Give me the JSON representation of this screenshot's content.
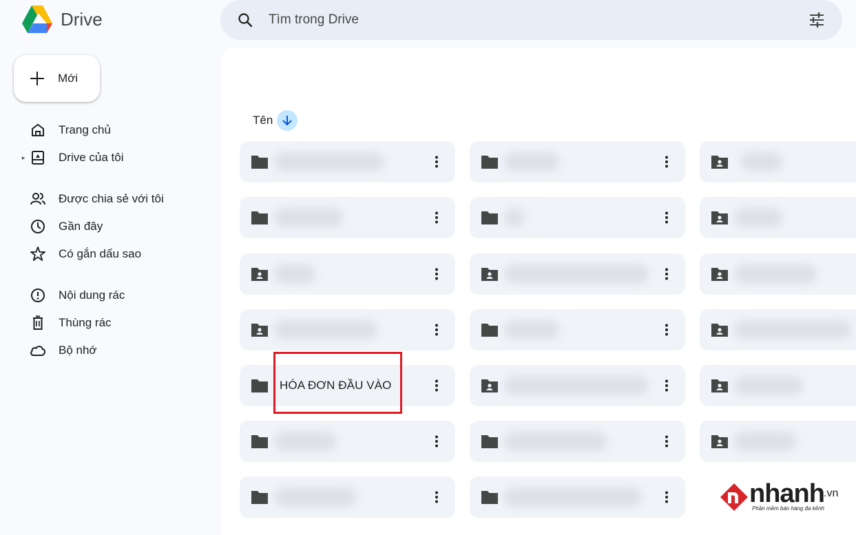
{
  "app": {
    "name": "Drive"
  },
  "search": {
    "placeholder": "Tìm trong Drive"
  },
  "new_button": {
    "label": "Mới"
  },
  "sidebar": {
    "items": [
      {
        "label": "Trang chủ",
        "icon": "home-icon"
      },
      {
        "label": "Drive của tôi",
        "icon": "my-drive-icon"
      },
      {
        "label": "Được chia sẻ với tôi",
        "icon": "shared-people-icon"
      },
      {
        "label": "Gần đây",
        "icon": "clock-icon"
      },
      {
        "label": "Có gắn dấu sao",
        "icon": "star-icon"
      },
      {
        "label": "Nội dung rác",
        "icon": "spam-icon"
      },
      {
        "label": "Thùng rác",
        "icon": "trash-icon"
      },
      {
        "label": "Bộ nhớ",
        "icon": "cloud-icon"
      }
    ]
  },
  "sort": {
    "label": "Tên"
  },
  "highlighted_folder": {
    "name": "HÓA ĐƠN ĐẦU VÀO"
  },
  "watermark": {
    "brand": "nhanh",
    "tld": ".vn",
    "tagline": "Phần mềm bán hàng đa kênh"
  },
  "colors": {
    "accent": "#c2e7ff",
    "highlight": "#e01b24",
    "card": "#f0f4f9"
  }
}
